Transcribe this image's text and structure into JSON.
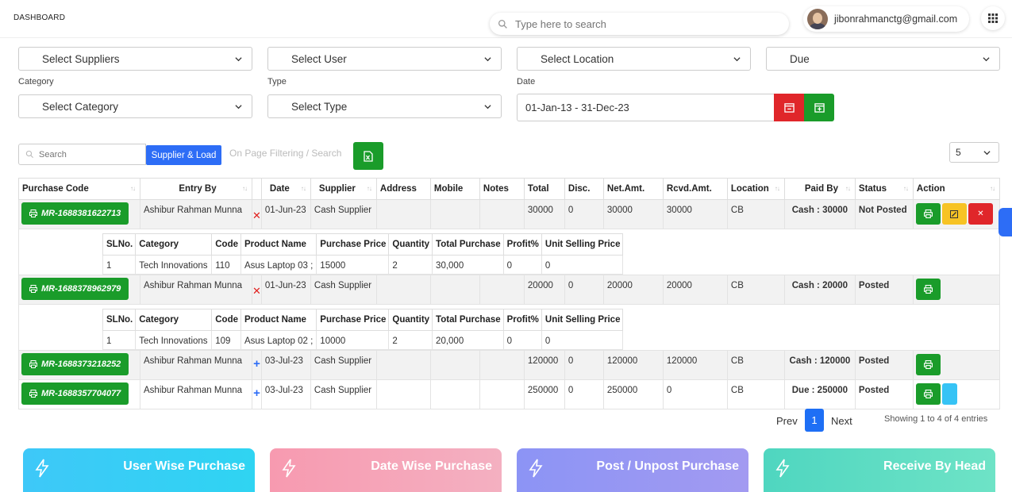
{
  "header": {
    "brand": "DASHBOARD",
    "search_placeholder": "Type here to search",
    "user_email": "jibonrahmanctg@gmail.com"
  },
  "filters": {
    "suppliers": "Select Suppliers",
    "user": "Select User",
    "location": "Select Location",
    "status": "Due",
    "category_label": "Category",
    "category": "Select Category",
    "type_label": "Type",
    "type": "Select Type",
    "date_label": "Date",
    "date_range": "01-Jan-13 - 31-Dec-23"
  },
  "toolbar": {
    "search_placeholder": "Search",
    "load_button": "Supplier & Load",
    "hint": "On Page Filtering / Search",
    "page_size": "5"
  },
  "table": {
    "headers": [
      "Purchase Code",
      "Entry By",
      "Date",
      "Supplier",
      "Address",
      "Mobile",
      "Notes",
      "Total",
      "Disc.",
      "Net.Amt.",
      "Rcvd.Amt.",
      "Location",
      "Paid By",
      "Status",
      "Action"
    ],
    "rows": [
      {
        "code": "MR-1688381622713",
        "entry": "Ashibur Rahman Munna",
        "date": "01-Jun-23",
        "supplier": "Cash Supplier",
        "address": "",
        "mobile": "",
        "notes": "",
        "total": "30000",
        "disc": "0",
        "net": "30000",
        "rcvd": "30000",
        "location": "CB",
        "paid": "Cash : 30000",
        "status": "Not Posted"
      },
      {
        "code": "MR-1688378962979",
        "entry": "Ashibur Rahman Munna",
        "date": "01-Jun-23",
        "supplier": "Cash Supplier",
        "address": "",
        "mobile": "",
        "notes": "",
        "total": "20000",
        "disc": "0",
        "net": "20000",
        "rcvd": "20000",
        "location": "CB",
        "paid": "Cash : 20000",
        "status": "Posted"
      },
      {
        "code": "MR-1688373218252",
        "entry": "Ashibur Rahman Munna",
        "date": "03-Jul-23",
        "supplier": "Cash Supplier",
        "address": "",
        "mobile": "",
        "notes": "",
        "total": "120000",
        "disc": "0",
        "net": "120000",
        "rcvd": "120000",
        "location": "CB",
        "paid": "Cash : 120000",
        "status": "Posted"
      },
      {
        "code": "MR-1688357704077",
        "entry": "Ashibur Rahman Munna",
        "date": "03-Jul-23",
        "supplier": "Cash Supplier",
        "address": "",
        "mobile": "",
        "notes": "",
        "total": "250000",
        "disc": "0",
        "net": "250000",
        "rcvd": "0",
        "location": "CB",
        "paid": "Due : 250000",
        "status": "Posted"
      }
    ]
  },
  "details": {
    "headers": [
      "SLNo.",
      "Category",
      "Code",
      "Product Name",
      "Purchase Price",
      "Quantity",
      "Total Purchase",
      "Profit%",
      "Unit Selling Price"
    ],
    "row1": [
      "1",
      "Tech Innovations",
      "110",
      "Asus Laptop 03 ;",
      "15000",
      "2",
      "30,000",
      "0",
      "0"
    ],
    "row2": [
      "1",
      "Tech Innovations",
      "109",
      "Asus Laptop 02 ;",
      "10000",
      "2",
      "20,000",
      "0",
      "0"
    ]
  },
  "pagination": {
    "prev": "Prev",
    "current": "1",
    "next": "Next",
    "info": "Showing 1 to 4 of 4 entries"
  },
  "cards": {
    "c1": "User Wise Purchase",
    "c2": "Date Wise Purchase",
    "c3": "Post / Unpost Purchase",
    "c4": "Receive By Head"
  }
}
